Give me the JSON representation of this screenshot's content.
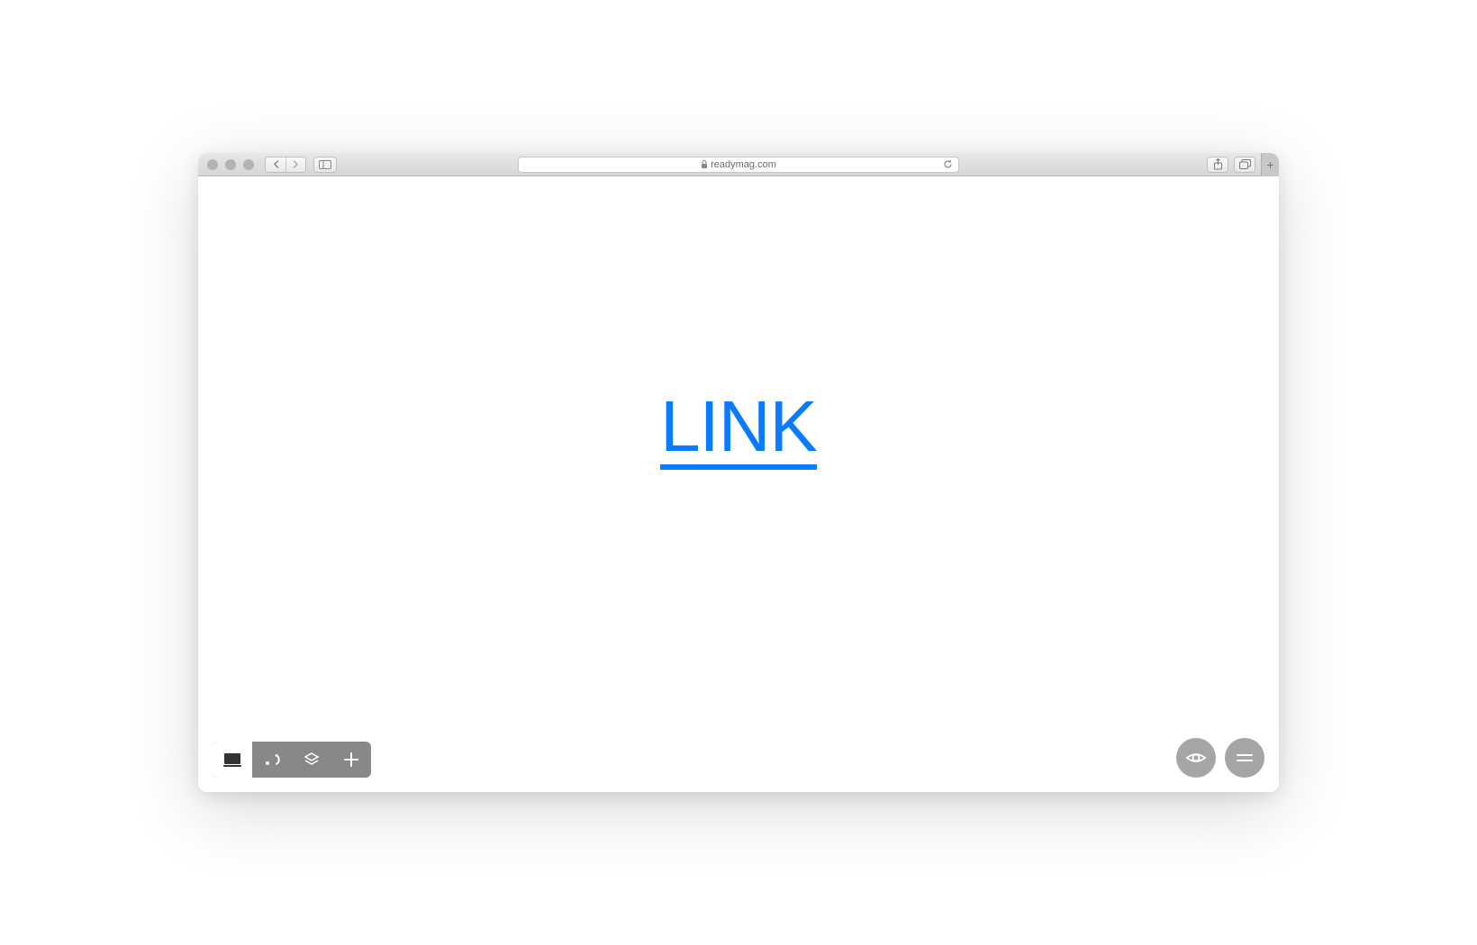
{
  "browser": {
    "url": "readymag.com"
  },
  "canvas": {
    "link_text": "LINK",
    "link_color": "#0a7aff"
  }
}
